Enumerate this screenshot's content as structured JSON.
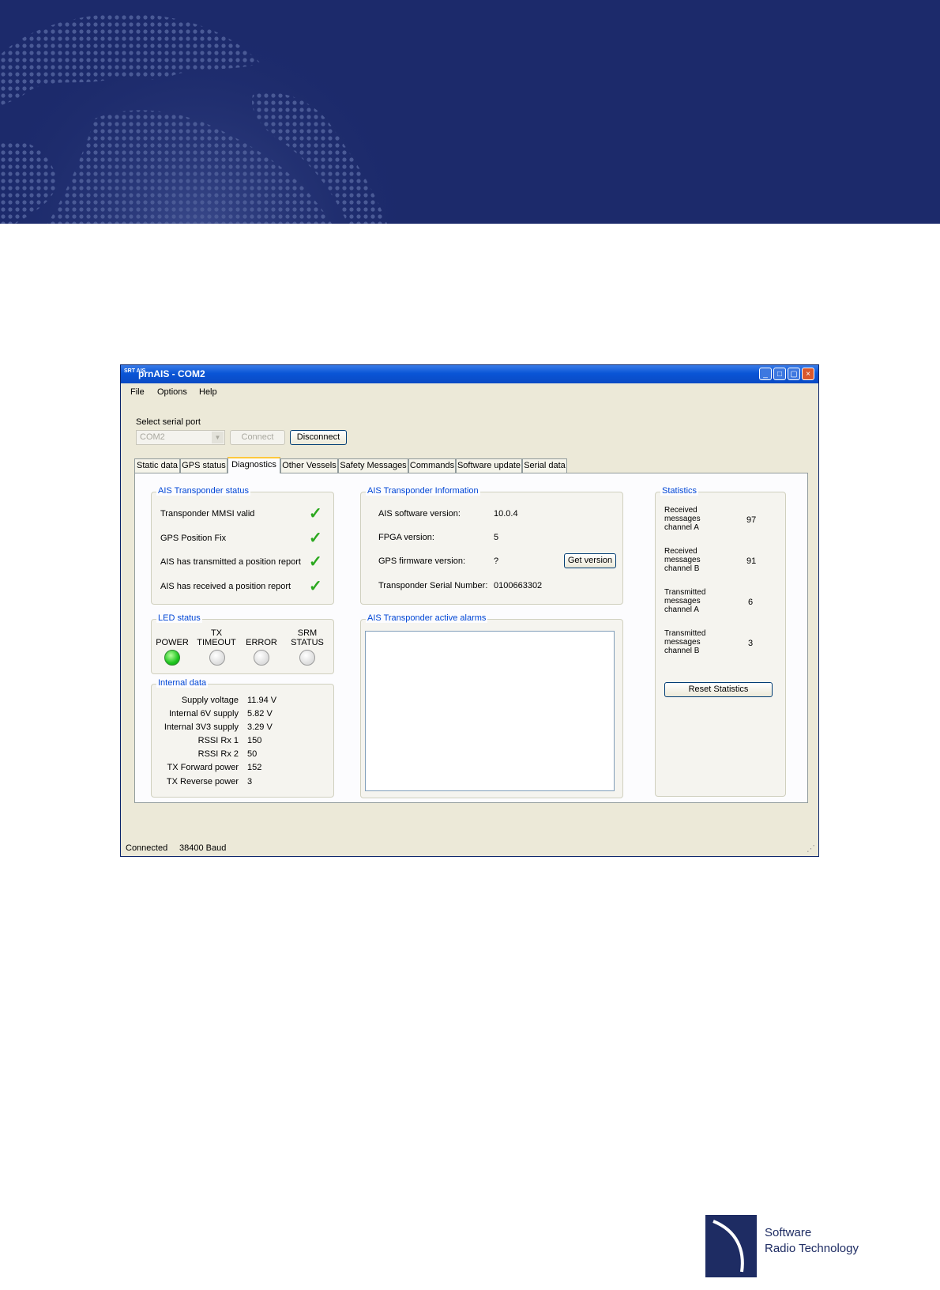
{
  "window": {
    "title": "prnAIS - COM2",
    "app_icon_text": "SRT AIS",
    "controls": [
      "_",
      "□",
      "▢",
      "×"
    ]
  },
  "menu": [
    "File",
    "Options",
    "Help"
  ],
  "serial": {
    "label": "Select serial port",
    "port": "COM2",
    "connect_label": "Connect",
    "disconnect_label": "Disconnect"
  },
  "tabs": [
    "Static data",
    "GPS status",
    "Diagnostics",
    "Other Vessels",
    "Safety Messages",
    "Commands",
    "Software update",
    "Serial data"
  ],
  "active_tab": "Diagnostics",
  "transponder_status": {
    "title": "AIS Transponder status",
    "items": [
      {
        "label": "Transponder MMSI valid",
        "ok": true
      },
      {
        "label": "GPS Position Fix",
        "ok": true
      },
      {
        "label": "AIS has transmitted a position report",
        "ok": true
      },
      {
        "label": "AIS has received a position report",
        "ok": true
      }
    ],
    "check_glyph": "✓"
  },
  "led_status": {
    "title": "LED status",
    "leds": [
      {
        "label": "POWER",
        "on": true
      },
      {
        "label": "TX TIMEOUT",
        "on": false
      },
      {
        "label": "ERROR",
        "on": false
      },
      {
        "label": "SRM STATUS",
        "on": false
      }
    ]
  },
  "internal_data": {
    "title": "Internal data",
    "rows": [
      {
        "label": "Supply voltage",
        "value": "11.94 V"
      },
      {
        "label": "Internal 6V supply",
        "value": "5.82 V"
      },
      {
        "label": "Internal 3V3 supply",
        "value": "3.29 V"
      },
      {
        "label": "RSSI Rx 1",
        "value": "150"
      },
      {
        "label": "RSSI Rx 2",
        "value": "50"
      },
      {
        "label": "TX Forward power",
        "value": "152"
      },
      {
        "label": "TX Reverse power",
        "value": "3"
      }
    ]
  },
  "transponder_info": {
    "title": "AIS Transponder Information",
    "rows": [
      {
        "label": "AIS software version:",
        "value": "10.0.4"
      },
      {
        "label": "FPGA version:",
        "value": "5"
      },
      {
        "label": "GPS firmware version:",
        "value": "?"
      },
      {
        "label": "Transponder Serial Number:",
        "value": "0100663302"
      }
    ],
    "get_version_label": "Get version"
  },
  "alarms": {
    "title": "AIS Transponder active alarms"
  },
  "statistics": {
    "title": "Statistics",
    "rows": [
      {
        "label": "Received messages channel A",
        "value": "97"
      },
      {
        "label": "Received messages channel B",
        "value": "91"
      },
      {
        "label": "Transmitted messages channel A",
        "value": "6"
      },
      {
        "label": "Transmitted messages channel B",
        "value": "3"
      }
    ],
    "reset_label": "Reset Statistics"
  },
  "statusbar": {
    "connection": "Connected",
    "baud": "38400 Baud"
  },
  "footer": {
    "brand_line1": "Software",
    "brand_line2": "Radio Technology"
  },
  "colors": {
    "banner": "#1c2a6b",
    "title_bar": "#0a55d6",
    "group_title": "#0046d5",
    "check": "#2ca81f",
    "led_on": "#1ec51e"
  }
}
